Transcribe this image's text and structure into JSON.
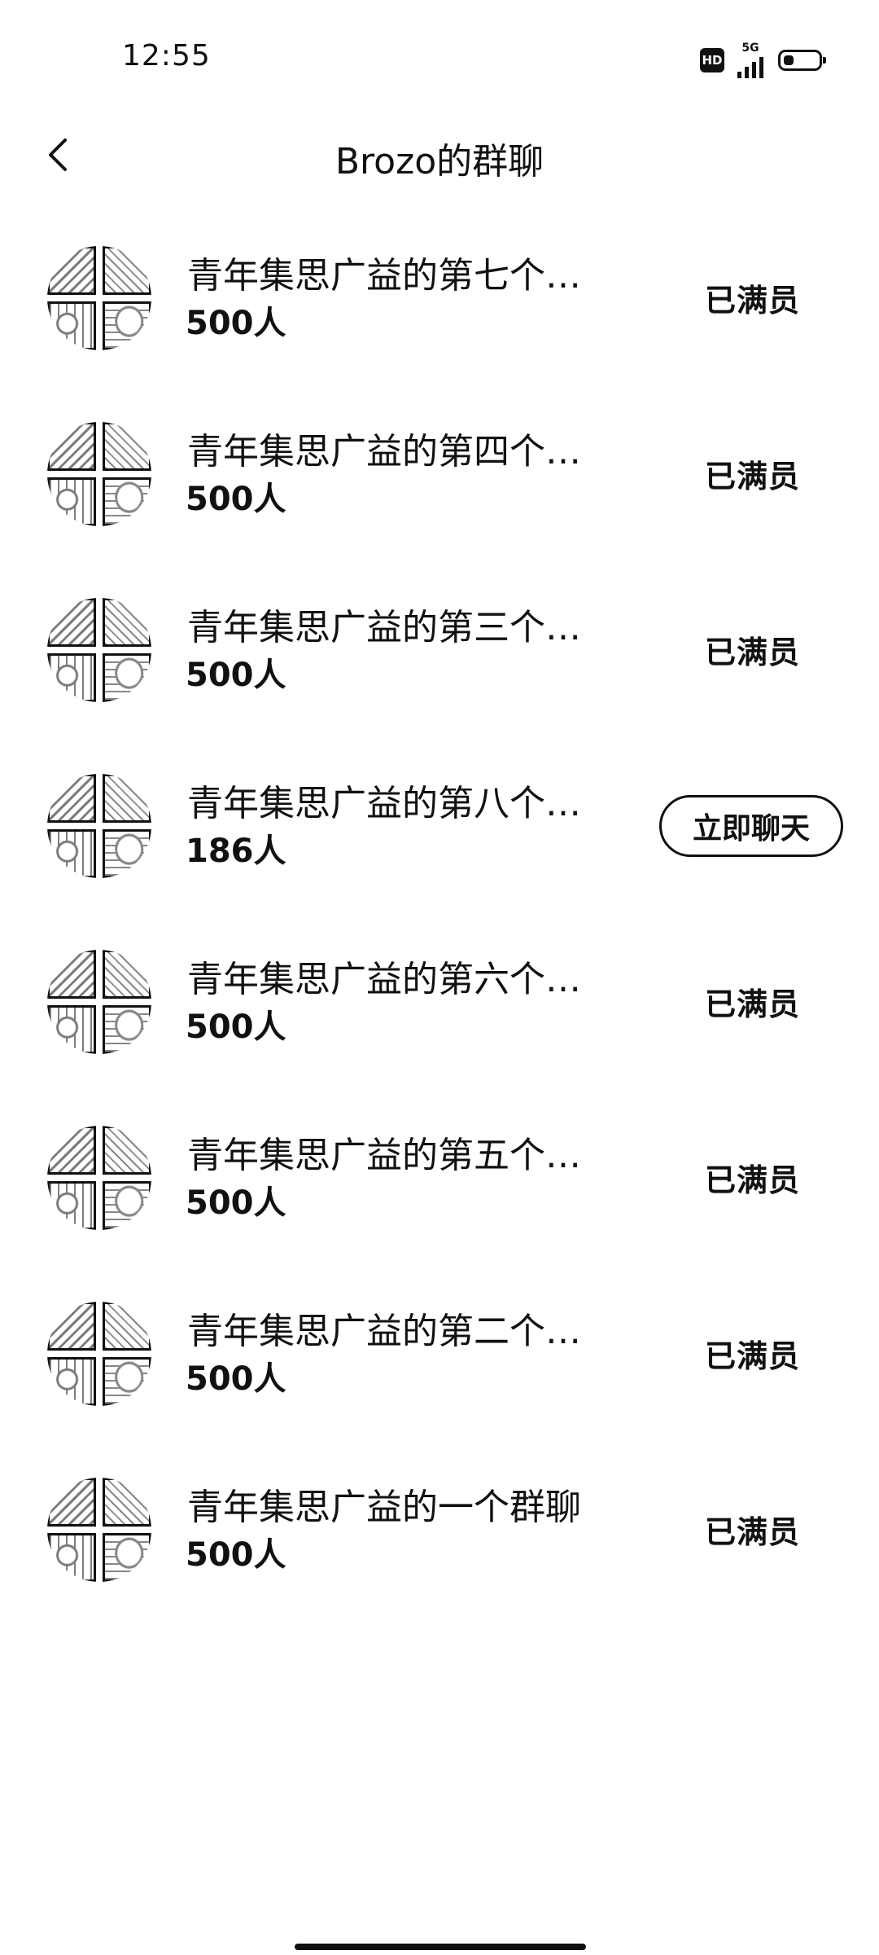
{
  "status_bar": {
    "time": "12:55",
    "hd_badge": "HD",
    "network": "5G",
    "icons": [
      "hd-icon",
      "signal-icon",
      "battery-icon"
    ]
  },
  "header": {
    "title": "Brozo的群聊",
    "back_icon": "chevron-left-icon"
  },
  "groups": [
    {
      "name": "青年集思广益的第七个…",
      "members": "500人",
      "action": "已满员"
    },
    {
      "name": "青年集思广益的第四个…",
      "members": "500人",
      "action": "已满员"
    },
    {
      "name": "青年集思广益的第三个…",
      "members": "500人",
      "action": "已满员"
    },
    {
      "name": "青年集思广益的第八个…",
      "members": "186人",
      "action": "立即聊天"
    },
    {
      "name": "青年集思广益的第六个…",
      "members": "500人",
      "action": "已满员"
    },
    {
      "name": "青年集思广益的第五个…",
      "members": "500人",
      "action": "已满员"
    },
    {
      "name": "青年集思广益的第二个…",
      "members": "500人",
      "action": "已满员"
    },
    {
      "name": "青年集思广益的一个群聊",
      "members": "500人",
      "action": "已满员"
    }
  ]
}
